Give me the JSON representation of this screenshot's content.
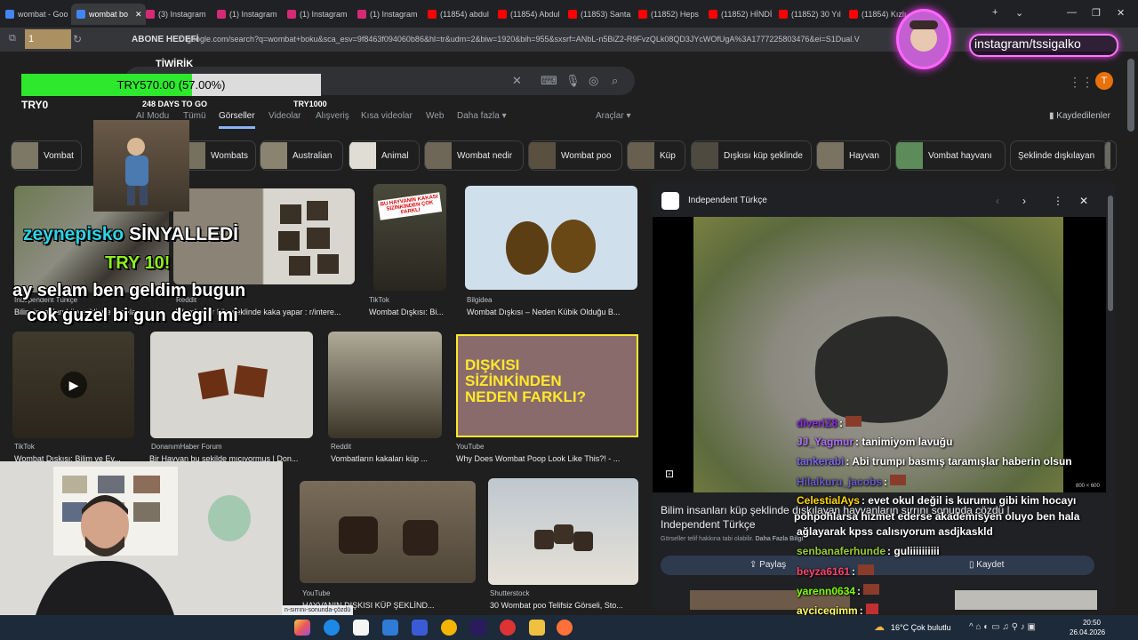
{
  "tabs": [
    {
      "label": "wombat - Goo",
      "color": "#4285f4"
    },
    {
      "label": "wombat bo",
      "color": "#4285f4",
      "active": true
    },
    {
      "label": "(3) Instagram",
      "color": "#d62976"
    },
    {
      "label": "(1) Instagram",
      "color": "#d62976"
    },
    {
      "label": "(1) Instagram",
      "color": "#d62976"
    },
    {
      "label": "(1) Instagram",
      "color": "#d62976"
    },
    {
      "label": "(11854) abdul",
      "color": "#ff0000"
    },
    {
      "label": "(11854) Abdul",
      "color": "#ff0000"
    },
    {
      "label": "(11853) Santa",
      "color": "#ff0000"
    },
    {
      "label": "(11852) Heps",
      "color": "#ff0000"
    },
    {
      "label": "(11852) HİNDİ",
      "color": "#ff0000"
    },
    {
      "label": "(11852) 30 Yıl",
      "color": "#ff0000"
    },
    {
      "label": "(11854) Kızlık",
      "color": "#ff0000"
    }
  ],
  "address_url": "google.com/search?q=wombat+boku&sca_esv=9f8463f094060b86&hl=tr&udm=2&biw=1920&bih=955&sxsrf=ANbL-n5BiZ2-R9FvzQLk08QD3JYcWOfUgA%3A1777225803476&ei=S1Dual.V",
  "overlay": {
    "abone_hedefi": "ABONE HEDEFİ",
    "abone_count": "1",
    "tiwirik": "TİWİRİK",
    "goal_amount": "TRY570.00 (57.00%)",
    "goal_percent": 57,
    "goal_start": "TRY0",
    "days_to_go": "248 DAYS TO GO",
    "goal_end": "TRY1000",
    "signal_user": "zeynepisko",
    "signal_word": "SİNYALLEDİ",
    "signal_amount": "TRY 10!",
    "tts_line1": "ay selam ben geldim bugun",
    "tts_line2": "cok guzel bi gun degil mi",
    "instagram_handle": "instagram/tssigalko"
  },
  "search": {
    "nav_tabs": [
      "AI Modu",
      "Tümü",
      "Görseller",
      "Videolar",
      "Alışveriş",
      "Kısa videolar",
      "Web",
      "Daha fazla ▾"
    ],
    "active_tab": "Görseller",
    "tools": "Araçlar ▾",
    "saved": "Kaydedilenler",
    "avatar_letter": "T"
  },
  "chips": [
    "Vombat",
    "Wombats",
    "Australian",
    "Animal",
    "Wombat nedir",
    "Wombat poo",
    "Küp",
    "Dışkısı küp şeklinde",
    "Hayvan",
    "Vombat hayvanı",
    "Şeklinde dışkılayan"
  ],
  "results": [
    {
      "source": "Independent Türkçe",
      "caption": "Bilim insanları küp şeklinde dışkılayan"
    },
    {
      "source": "Reddit",
      "caption": "Wombatlar küp şeklinde kaka yapar : r/intere..."
    },
    {
      "source": "TikTok",
      "caption": "Wombat Dışkısı: Bi..."
    },
    {
      "source": "Bilgidea",
      "caption": "Wombat Dışkısı – Neden Kübik Olduğu B..."
    },
    {
      "source": "TikTok",
      "caption": "Wombat Dışkısı: Bilim ve Ev..."
    },
    {
      "source": "DonanımHaber Forum",
      "caption": "Bir Hayvan bu şekilde mıçıyormuş | Don..."
    },
    {
      "source": "Reddit",
      "caption": "Vombatların kakaları küp ..."
    },
    {
      "source": "YouTube",
      "caption": "Why Does Wombat Poop Look Like This?! - ..."
    },
    {
      "source": "YouTube",
      "caption": "HAYVANIN DIŞKISI KÜP ŞEKLİND..."
    },
    {
      "source": "Shutterstock",
      "caption": "30 Wombat poo Telifsiz Görseli, Sto..."
    }
  ],
  "thumb_text": {
    "dis_line1": "DIŞKISI",
    "dis_line2": "SİZİNKİNDEN",
    "dis_line3": "NEDEN FARKLI?",
    "tiktok_badge": "BU HAYVANIN KAKASI SİZİNKİNDEN ÇOK FARKLI"
  },
  "preview": {
    "source": "Independent Türkçe",
    "title": "Bilim insanları küp şeklinde dışkılayan hayvanların sırrını sonunda çözdü |",
    "title2": "Independent Türkçe",
    "license": "Görseller telif hakkına tabi olabilir.",
    "more_info": "Daha Fazla Bilgi",
    "share": "Paylaş",
    "save": "Kaydet",
    "dimensions": "800 × 600"
  },
  "chat": [
    {
      "user": "diveriZ8",
      "msg": ":",
      "color": "#8a2be2"
    },
    {
      "user": "JJ_Yagmur",
      "msg": ": tanimiyom lavuğu",
      "color": "#b070ff"
    },
    {
      "user": "tankerabi",
      "msg": ": Abi trumpı basmış taramışlar haberin olsun",
      "color": "#7b68ee"
    },
    {
      "user": "Hilalkuru_jacobs",
      "msg": ":",
      "color": "#6a5acd"
    },
    {
      "user": "CelestialAys",
      "msg": ": evet okul değil is kurumu gibi kim hocayı",
      "color": "#ffd700"
    },
    {
      "user": "",
      "msg": "pohpohlarsa hizmet ederse akademisyen oluyo ben hala",
      "color": "#fff"
    },
    {
      "user": "",
      "msg": "ağlayarak kpss calısıyorum asdjkaskld",
      "color": "#fff"
    },
    {
      "user": "senbanaferhunde",
      "msg": ": guliiiiiiiiii",
      "color": "#9acd32"
    },
    {
      "user": "beyza6161",
      "msg": ":",
      "color": "#ff4466"
    },
    {
      "user": "yarenn0634",
      "msg": ":",
      "color": "#7cfc00"
    },
    {
      "user": "aycicegimm",
      "msg": ":",
      "color": "#ffff66"
    }
  ],
  "status_tooltip": "n-sırrını-sonunda-çözdü",
  "taskbar": {
    "weather": "16°C  Çok bulutlu",
    "time": "20:50",
    "date": "26.04.2026"
  }
}
